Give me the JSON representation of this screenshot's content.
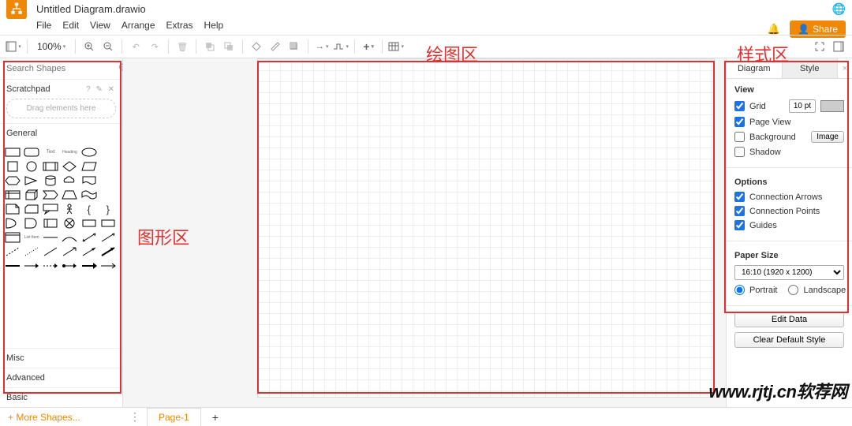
{
  "title": "Untitled Diagram.drawio",
  "menu": {
    "file": "File",
    "edit": "Edit",
    "view": "View",
    "arrange": "Arrange",
    "extras": "Extras",
    "help": "Help"
  },
  "share_label": "Share",
  "toolbar": {
    "zoom": "100%"
  },
  "sidebar": {
    "search_placeholder": "Search Shapes",
    "scratchpad": "Scratchpad",
    "drag_hint": "Drag elements here",
    "cats": {
      "general": "General",
      "misc": "Misc",
      "advanced": "Advanced",
      "basic": "Basic"
    },
    "more_shapes": "+ More Shapes...",
    "shape_text": "Text",
    "shape_heading": "Heading",
    "shape_listitem": "List Item"
  },
  "page_tab": "Page-1",
  "right": {
    "tab_diagram": "Diagram",
    "tab_style": "Style",
    "view": "View",
    "grid": "Grid",
    "grid_size": "10 pt",
    "page_view": "Page View",
    "background": "Background",
    "image": "Image",
    "shadow": "Shadow",
    "options": "Options",
    "conn_arrows": "Connection Arrows",
    "conn_points": "Connection Points",
    "guides": "Guides",
    "paper_size": "Paper Size",
    "paper_value": "16:10 (1920 x 1200)",
    "portrait": "Portrait",
    "landscape": "Landscape",
    "edit_data": "Edit Data",
    "clear_style": "Clear Default Style"
  },
  "annot": {
    "canvas": "绘图区",
    "style": "样式区",
    "shapes": "图形区"
  },
  "watermark": "www.rjtj.cn软荐网"
}
